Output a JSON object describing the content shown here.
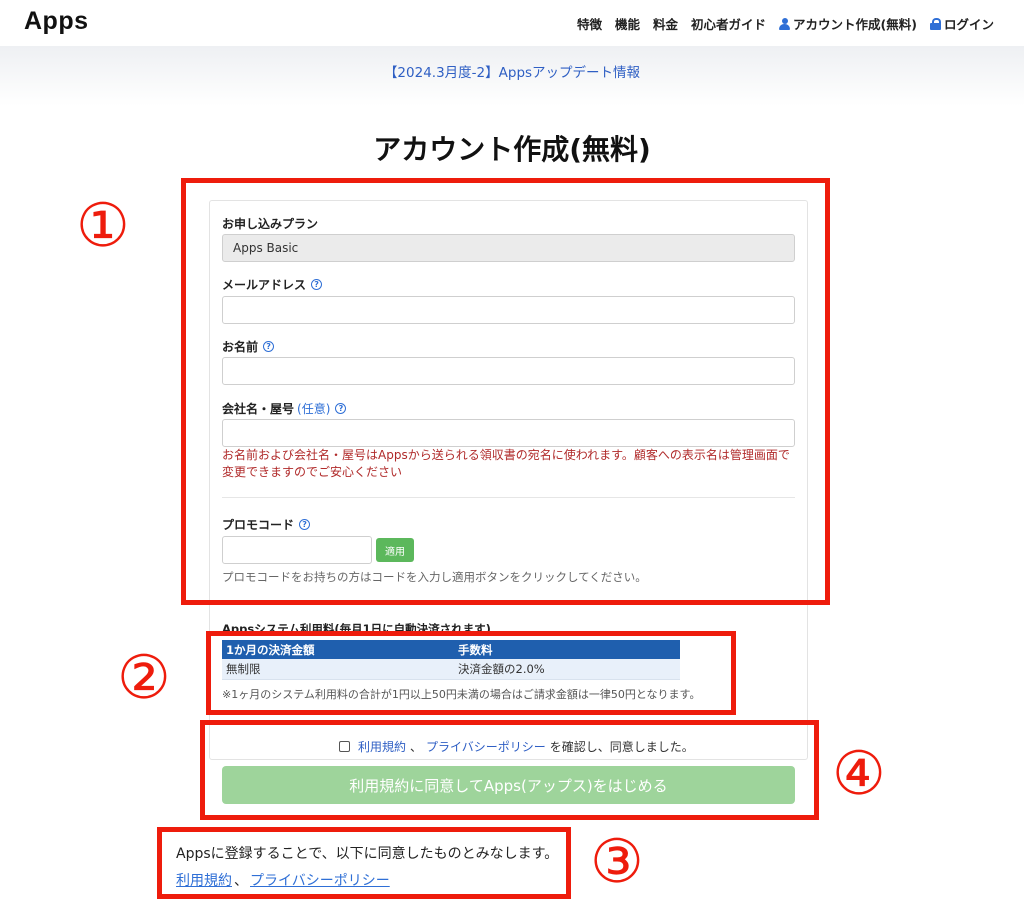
{
  "header": {
    "logo": "Apps",
    "nav": [
      "特徴",
      "機能",
      "料金",
      "初心者ガイド"
    ],
    "signup": "アカウント作成(無料)",
    "login": "ログイン",
    "signup_icon": "user-icon",
    "login_icon": "lock-icon"
  },
  "banner": {
    "link": "【2024.3月度-2】Appsアップデート情報"
  },
  "page_title": "アカウント作成(無料)",
  "form": {
    "plan_label": "お申し込みプラン",
    "plan_value": "Apps Basic",
    "email_label": "メールアドレス",
    "name_label": "お名前",
    "company_label": "会社名・屋号",
    "company_optional": "(任意)",
    "help_icon": "?",
    "name_note": "お名前および会社名・屋号はAppsから送られる領収書の宛名に使われます。顧客への表示名は管理画面で変更できますのでご安心ください",
    "promo_label": "プロモコード",
    "promo_apply": "適用",
    "promo_help": "プロモコードをお持ちの方はコードを入力し適用ボタンをクリックしてください。"
  },
  "fees": {
    "title": "Appsシステム利用料(毎月1日に自動決済されます)",
    "columns": [
      "1か月の決済金額",
      "手数料"
    ],
    "rows": [
      [
        "無制限",
        "決済金額の2.0%"
      ]
    ],
    "note": "※1ヶ月のシステム利用料の合計が1円以上50円未満の場合はご請求金額は一律50円となります。"
  },
  "agreement": {
    "terms": "利用規約",
    "separator": "、",
    "privacy": "プライバシーポリシー",
    "suffix": "を確認し、同意しました。",
    "start_button": "利用規約に同意してApps(アップス)をはじめる"
  },
  "consent": {
    "text": "Appsに登録することで、以下に同意したものとみなします。",
    "terms": "利用規約",
    "separator": "、",
    "privacy": "プライバシーポリシー"
  },
  "annotations": {
    "numbers": [
      "①",
      "②",
      "③",
      "④"
    ],
    "color": "#ee1c0c"
  }
}
